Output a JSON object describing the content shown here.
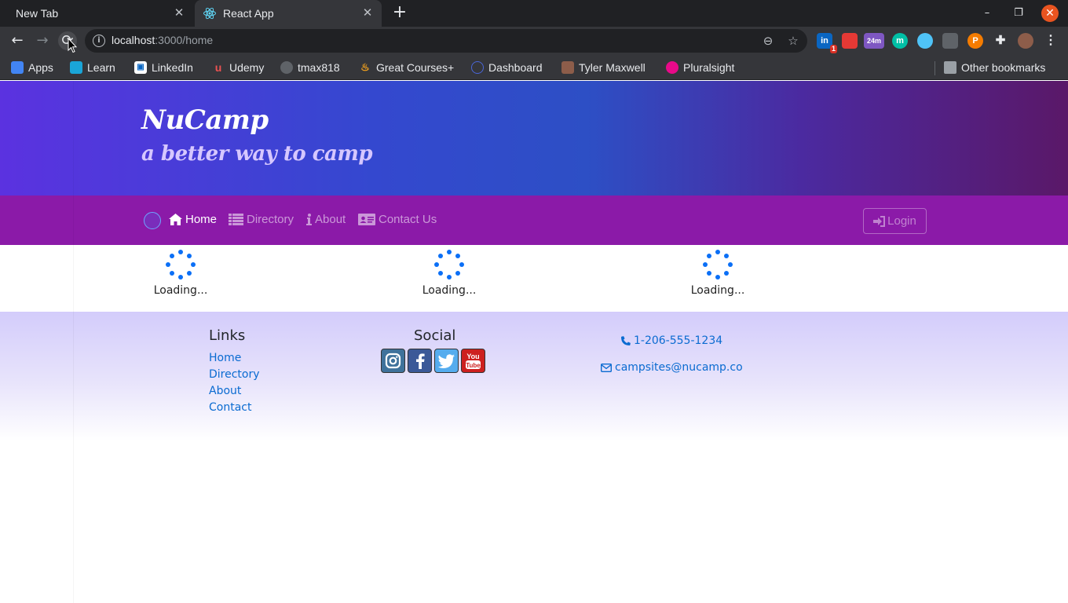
{
  "browser": {
    "tabs": [
      {
        "title": "New Tab",
        "active": false
      },
      {
        "title": "React App",
        "active": true
      }
    ],
    "url": {
      "host": "localhost",
      "rest": ":3000/home"
    },
    "extensions": [
      {
        "name": "linkedin-ext",
        "label": "in",
        "color": "#0a66c2",
        "badge": "1"
      },
      {
        "name": "red-ext",
        "label": "",
        "color": "#e53935"
      },
      {
        "name": "timer-ext",
        "label": "24m",
        "color": "#7e57c2"
      },
      {
        "name": "m-ext",
        "label": "m",
        "color": "#00bfa5"
      },
      {
        "name": "v-ext",
        "label": "",
        "color": "#4fc3f7"
      },
      {
        "name": "camera-ext",
        "label": "",
        "color": "#5f6368"
      },
      {
        "name": "p-ext",
        "label": "P",
        "color": "#f57c00"
      }
    ],
    "bookmarks": [
      {
        "label": "Apps",
        "icon": "apps-grid-icon",
        "color": "#4285f4"
      },
      {
        "label": "Learn",
        "icon": "learn-icon",
        "color": "#1aa5d8"
      },
      {
        "label": "LinkedIn",
        "icon": "linkedin-icon",
        "color": "#ffffff"
      },
      {
        "label": "Udemy",
        "icon": "udemy-icon",
        "color": "#ec5252"
      },
      {
        "label": "tmax818",
        "icon": "github-icon",
        "color": "#e8eaed"
      },
      {
        "label": "Great Courses+",
        "icon": "flame-icon",
        "color": "#f4a21d"
      },
      {
        "label": "Dashboard",
        "icon": "dashboard-icon",
        "color": "#4a66d8"
      },
      {
        "label": "Tyler Maxwell",
        "icon": "avatar-icon",
        "color": "#8d5d4a"
      },
      {
        "label": "Pluralsight",
        "icon": "pluralsight-icon",
        "color": "#e80a89"
      }
    ],
    "other_bookmarks": "Other bookmarks"
  },
  "jumbotron": {
    "title": "NuCamp",
    "subtitle": "a better way to camp"
  },
  "nav": {
    "items": [
      {
        "label": "Home",
        "icon": "home-icon",
        "active": true
      },
      {
        "label": "Directory",
        "icon": "list-icon",
        "active": false
      },
      {
        "label": "About",
        "icon": "info-icon",
        "active": false
      },
      {
        "label": "Contact Us",
        "icon": "address-card-icon",
        "active": false
      }
    ],
    "login": "Login"
  },
  "loading": [
    "Loading...",
    "Loading...",
    "Loading..."
  ],
  "footer": {
    "links_title": "Links",
    "links": [
      "Home",
      "Directory",
      "About",
      "Contact"
    ],
    "social_title": "Social",
    "social": [
      {
        "name": "instagram",
        "color": "#3f729b"
      },
      {
        "name": "facebook",
        "color": "#3b5998"
      },
      {
        "name": "twitter",
        "color": "#55acee"
      },
      {
        "name": "youtube",
        "color": "#cd201f"
      }
    ],
    "phone": "1-206-555-1234",
    "email": "campsites@nucamp.co"
  }
}
